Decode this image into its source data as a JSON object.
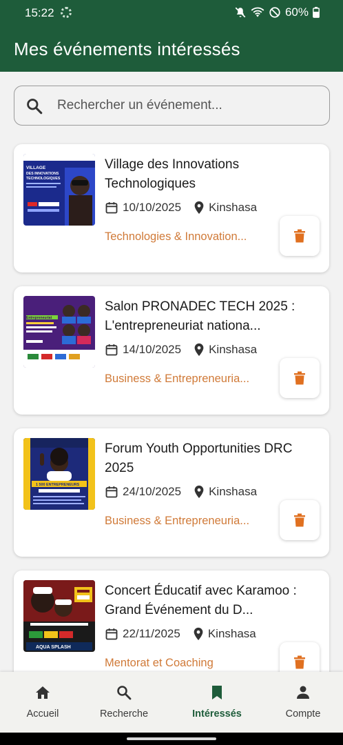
{
  "status_bar": {
    "time": "15:22",
    "battery": "60%"
  },
  "app_bar": {
    "title": "Mes événements intéressés"
  },
  "search": {
    "placeholder": "Rechercher un événement..."
  },
  "events": [
    {
      "title": "Village des Innovations Technologiques",
      "date": "10/10/2025",
      "location": "Kinshasa",
      "category": "Technologies & Innovation..."
    },
    {
      "title": "Salon PRONADEC TECH 2025 : L'entrepreneuriat nationa...",
      "date": "14/10/2025",
      "location": "Kinshasa",
      "category": "Business & Entrepreneuria..."
    },
    {
      "title": "Forum Youth Opportunities DRC 2025",
      "date": "24/10/2025",
      "location": "Kinshasa",
      "category": "Business & Entrepreneuria..."
    },
    {
      "title": "Concert Éducatif avec Karamoo : Grand Événement du D...",
      "date": "22/11/2025",
      "location": "Kinshasa",
      "category": "Mentorat et Coaching"
    }
  ],
  "thumb_text": {
    "event1_poster": "VILLAGE DES INNOVATIONS TECHNOLOGIQUES",
    "event2_poster": "Entrepreneuriat National",
    "event3_poster": "1 500 ENTREPRENEURS POUR BÂTIR LE CONGO DE DEMAIN",
    "event4_poster": "AQUA SPLASH"
  },
  "bottom_nav": {
    "items": [
      {
        "label": "Accueil",
        "icon": "home-icon"
      },
      {
        "label": "Recherche",
        "icon": "search-icon"
      },
      {
        "label": "Intéressés",
        "icon": "bookmark-icon"
      },
      {
        "label": "Compte",
        "icon": "person-icon"
      }
    ],
    "active_index": 2
  },
  "colors": {
    "primary": "#1e5c3a",
    "accent": "#d07a38",
    "delete": "#e07020",
    "background": "#f2f2f2"
  }
}
